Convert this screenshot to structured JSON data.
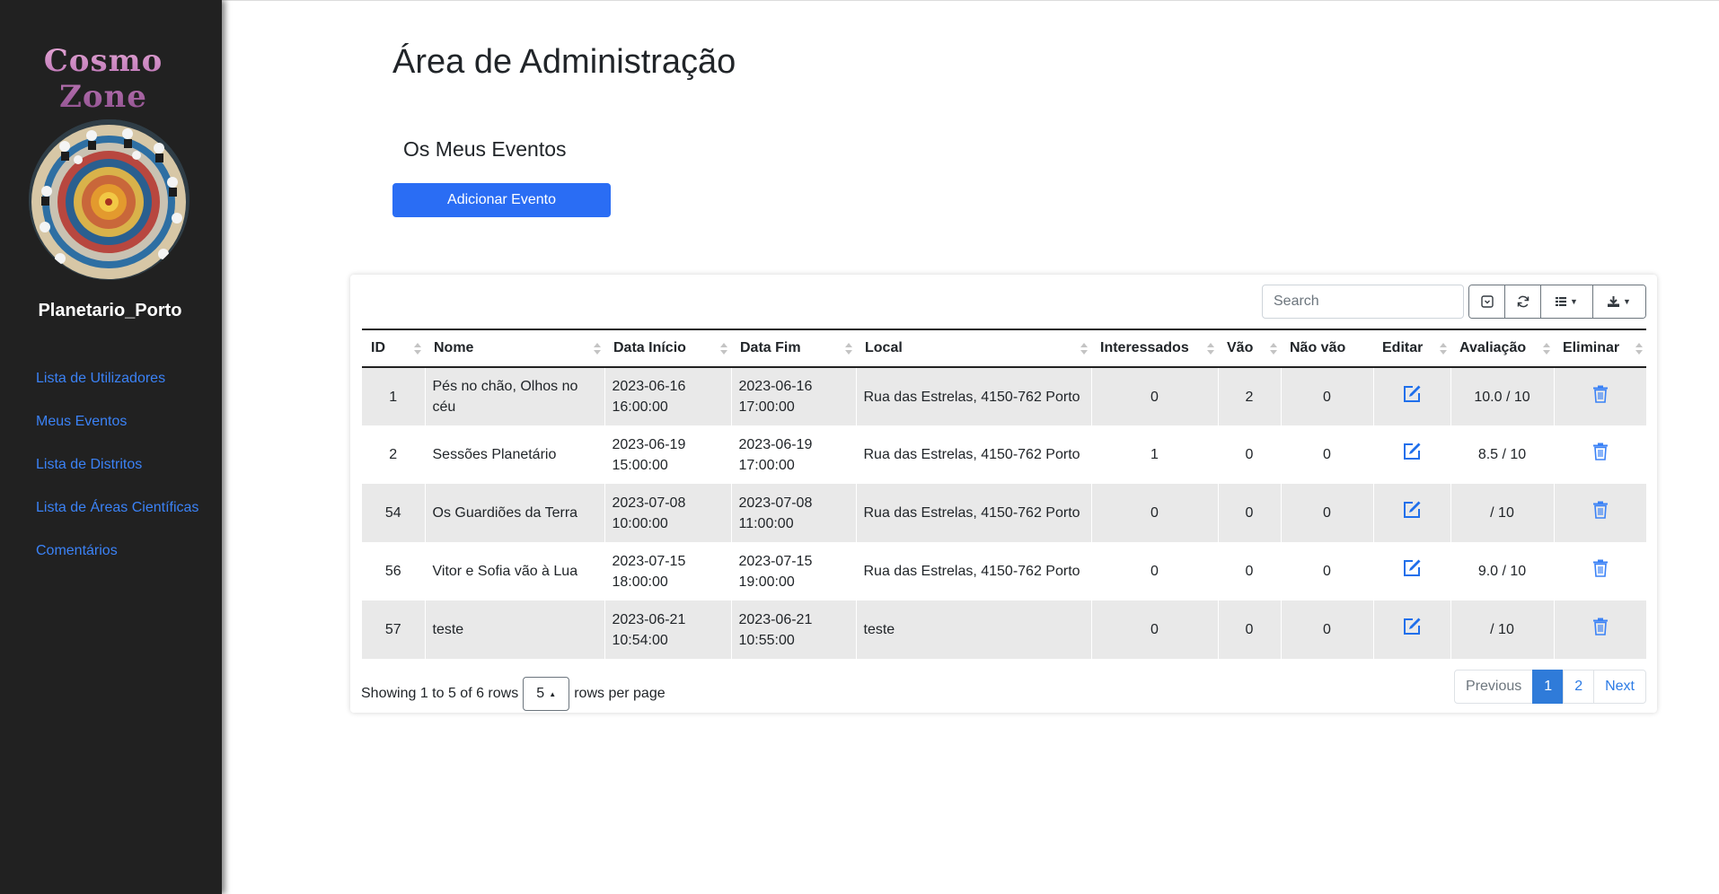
{
  "sidebar": {
    "brand": "Cosmo Zone",
    "username": "Planetario_Porto",
    "nav": [
      {
        "label": "Lista de Utilizadores"
      },
      {
        "label": "Meus Eventos"
      },
      {
        "label": "Lista de Distritos"
      },
      {
        "label": "Lista de Áreas Científicas"
      },
      {
        "label": "Comentários"
      }
    ]
  },
  "main": {
    "page_title": "Área de Administração",
    "section_title": "Os Meus Eventos",
    "add_button": "Adicionar Evento"
  },
  "toolbar": {
    "search_placeholder": "Search",
    "buttons": [
      "toggle-icon",
      "refresh-icon",
      "columns-icon",
      "export-icon"
    ]
  },
  "table": {
    "headers": [
      "ID",
      "Nome",
      "Data Início",
      "Data Fim",
      "Local",
      "Interessados",
      "Vão",
      "Não vão",
      "Editar",
      "Avaliação",
      "Eliminar"
    ],
    "rows": [
      {
        "id": "1",
        "nome": "Pés no chão, Olhos no céu",
        "inicio": "2023-06-16 16:00:00",
        "fim": "2023-06-16 17:00:00",
        "local": "Rua das Estrelas, 4150-762 Porto",
        "interessados": "0",
        "vao": "2",
        "nao_vao": "0",
        "avaliacao": "10.0 / 10"
      },
      {
        "id": "2",
        "nome": "Sessões Planetário",
        "inicio": "2023-06-19 15:00:00",
        "fim": "2023-06-19 17:00:00",
        "local": "Rua das Estrelas, 4150-762 Porto",
        "interessados": "1",
        "vao": "0",
        "nao_vao": "0",
        "avaliacao": "8.5 / 10"
      },
      {
        "id": "54",
        "nome": "Os Guardiões da Terra",
        "inicio": "2023-07-08 10:00:00",
        "fim": "2023-07-08 11:00:00",
        "local": "Rua das Estrelas, 4150-762 Porto",
        "interessados": "0",
        "vao": "0",
        "nao_vao": "0",
        "avaliacao": " / 10"
      },
      {
        "id": "56",
        "nome": "Vitor e Sofia vão à Lua",
        "inicio": "2023-07-15 18:00:00",
        "fim": "2023-07-15 19:00:00",
        "local": "Rua das Estrelas, 4150-762 Porto",
        "interessados": "0",
        "vao": "0",
        "nao_vao": "0",
        "avaliacao": "9.0 / 10"
      },
      {
        "id": "57",
        "nome": "teste",
        "inicio": "2023-06-21 10:54:00",
        "fim": "2023-06-21 10:55:00",
        "local": "teste",
        "interessados": "0",
        "vao": "0",
        "nao_vao": "0",
        "avaliacao": " / 10"
      }
    ]
  },
  "footer": {
    "showing_text": "Showing 1 to 5 of 6 rows",
    "page_size": "5",
    "rows_per_page_text": "rows per page",
    "pagination": {
      "previous": "Previous",
      "pages": [
        "1",
        "2"
      ],
      "next": "Next"
    }
  },
  "colors": {
    "sidebar_bg": "#212121",
    "link": "#3b82f6",
    "primary_button": "#2a6df4",
    "row_stripe": "#e9e9e9",
    "page_active": "#2f7bd9"
  }
}
